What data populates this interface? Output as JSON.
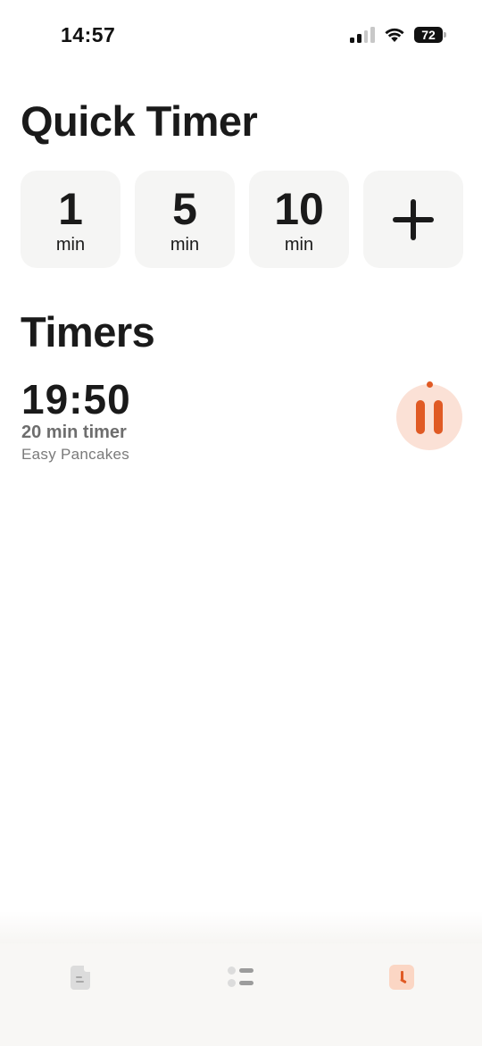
{
  "status_bar": {
    "time": "14:57",
    "battery_level": "72"
  },
  "quick_timer": {
    "title": "Quick Timer",
    "presets": [
      {
        "value": "1",
        "unit": "min"
      },
      {
        "value": "5",
        "unit": "min"
      },
      {
        "value": "10",
        "unit": "min"
      }
    ],
    "add_icon": "plus-icon"
  },
  "timers": {
    "title": "Timers",
    "items": [
      {
        "remaining": "19:50",
        "name": "20 min timer",
        "recipe": "Easy Pancakes",
        "action_icon": "pause-icon"
      }
    ]
  },
  "tab_bar": {
    "tabs": [
      {
        "icon": "document-icon",
        "active": false
      },
      {
        "icon": "list-icon",
        "active": false
      },
      {
        "icon": "clock-icon",
        "active": true
      }
    ]
  },
  "colors": {
    "accent": "#e05a24",
    "accent_bg": "#fbe1d6",
    "tile_bg": "#f5f5f4",
    "tab_bar_bg": "#f8f7f5"
  }
}
